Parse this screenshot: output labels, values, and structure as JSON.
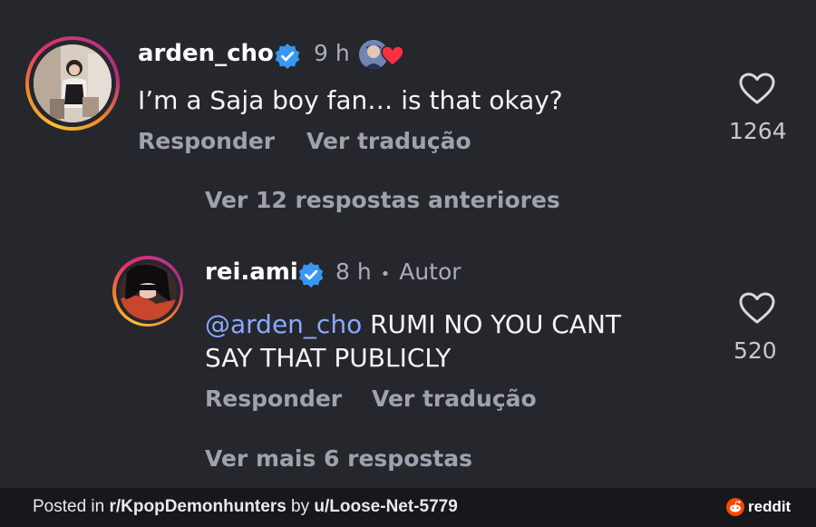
{
  "comments": [
    {
      "username": "arden_cho",
      "time": "9 h",
      "text": "I’m a Saja boy fan… is that okay?",
      "reply_label": "Responder",
      "translate_label": "Ver tradução",
      "likes": "1264",
      "liked_by_creator": true
    },
    {
      "username": "rei.ami",
      "time": "8 h",
      "separator": "•",
      "author_tag": "Autor",
      "mention": "@arden_cho",
      "text_line1": " RUMI NO YOU CANT",
      "text_line2": "SAY THAT PUBLICLY",
      "reply_label": "Responder",
      "translate_label": "Ver tradução",
      "likes": "520"
    }
  ],
  "view_previous_replies": "Ver 12 respostas anteriores",
  "view_more_replies": "Ver mais 6 respostas",
  "footer": {
    "prefix": "Posted in ",
    "subreddit": "r/KpopDemonhunters",
    "middle": " by ",
    "user": "u/Loose-Net-5779",
    "brand": "reddit"
  },
  "colors": {
    "background": "#25272d",
    "verified": "#3897f0",
    "mention": "#8aa9ff",
    "heart_red": "#ff3040"
  }
}
